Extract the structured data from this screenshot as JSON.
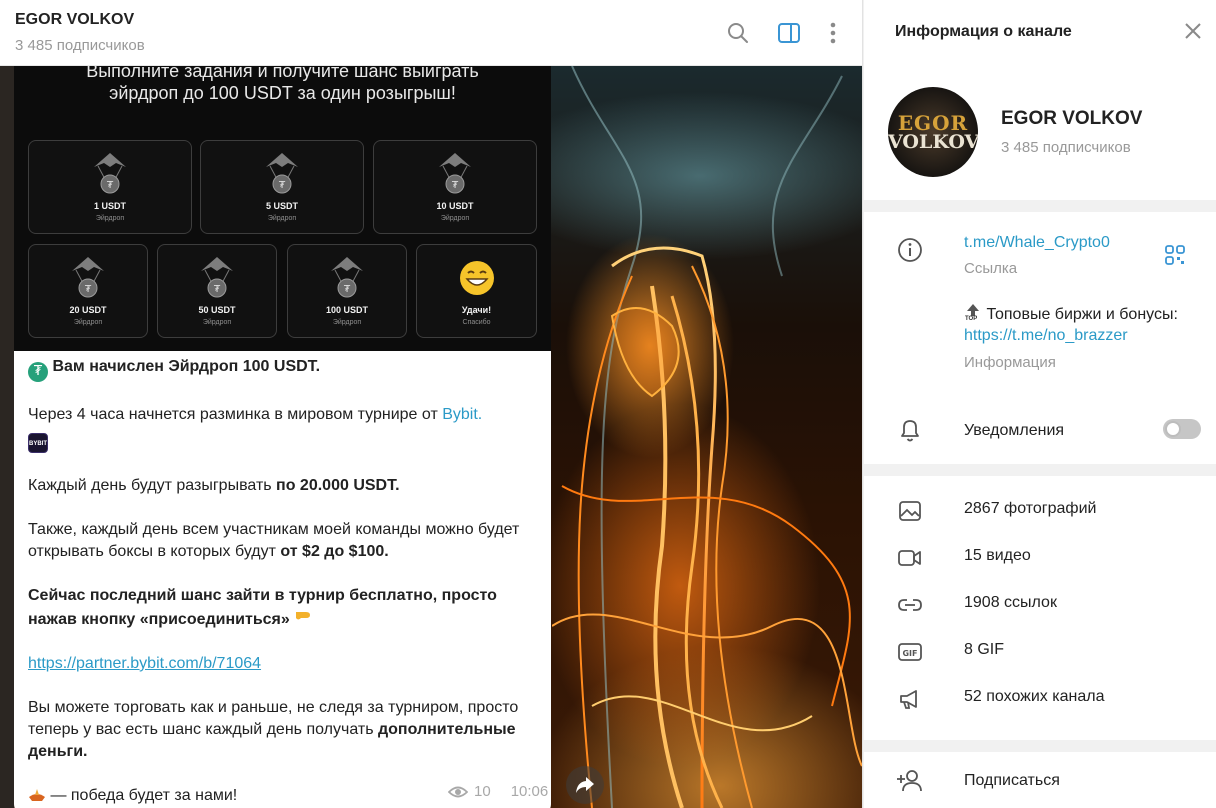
{
  "chat_header": {
    "title": "EGOR VOLKOV",
    "subscribers": "3 485 подписчиков"
  },
  "promo": {
    "text_line1": "Выполните задания и получите шанс выиграть",
    "text_line2": "эйрдроп до 100 USDT за один розыгрыш!",
    "cards": [
      {
        "amount": "1 USDT",
        "sub": "Эйрдроп"
      },
      {
        "amount": "5 USDT",
        "sub": "Эйрдроп"
      },
      {
        "amount": "10 USDT",
        "sub": "Эйрдроп"
      },
      {
        "amount": "20 USDT",
        "sub": "Эйрдроп"
      },
      {
        "amount": "50 USDT",
        "sub": "Эйрдроп"
      },
      {
        "amount": "100 USDT",
        "sub": "Эйрдроп"
      },
      {
        "amount": "Удачи!",
        "sub": "Спасибо"
      }
    ]
  },
  "message": {
    "line1": "Вам начислен Эйрдроп 100 USDT.",
    "line2_pre": "Через 4 часа начнется разминка в мировом турнире от ",
    "line2_link": "Bybit.",
    "bybit_badge": "BYBIT",
    "line3_pre": "Каждый день будут разыгрывать ",
    "line3_bold": "по 20.000 USDT.",
    "line4_pre": "Также, каждый день всем участникам моей команды можно будет открывать боксы в которых будут ",
    "line4_bold": "от $2 до $100.",
    "line5_bold": "Сейчас последний шанс зайти в турнир бесплатно, просто нажав кнопку «присоединиться»",
    "line6_link": "https://partner.bybit.com/b/71064",
    "line7_pre": "Вы можете торговать как и раньше, не следя за турниром, просто теперь у вас есть шанс каждый день получать ",
    "line7_bold": "дополнительные деньги.",
    "line8": " — победа будет за нами!",
    "views": "10",
    "time": "10:06"
  },
  "panel": {
    "title": "Информация о канале",
    "channel_name": "EGOR VOLKOV",
    "channel_subs": "3 485 подписчиков",
    "avatar_text_top": "EGOR",
    "avatar_text_bottom": "VOLKOV",
    "link": "t.me/Whale_Crypto0",
    "link_sub": "Ссылка",
    "info_prefix_glyph": "TOP",
    "info_line1": "Топовые биржи и бонусы:",
    "info_link": "https://t.me/no_brazzer",
    "info_sub": "Информация",
    "notifications": "Уведомления",
    "notifications_on": false,
    "media": [
      {
        "icon": "photo-icon",
        "label": "2867 фотографий"
      },
      {
        "icon": "video-icon",
        "label": "15 видео"
      },
      {
        "icon": "link-icon",
        "label": "1908 ссылок"
      },
      {
        "icon": "gif-icon",
        "label": "8 GIF"
      },
      {
        "icon": "megaphone-icon",
        "label": "52 похожих канала"
      }
    ],
    "subscribe": "Подписаться"
  },
  "colors": {
    "accent": "#2b9ac7",
    "header_icon_active": "#3a95d4",
    "muted": "#999999"
  }
}
